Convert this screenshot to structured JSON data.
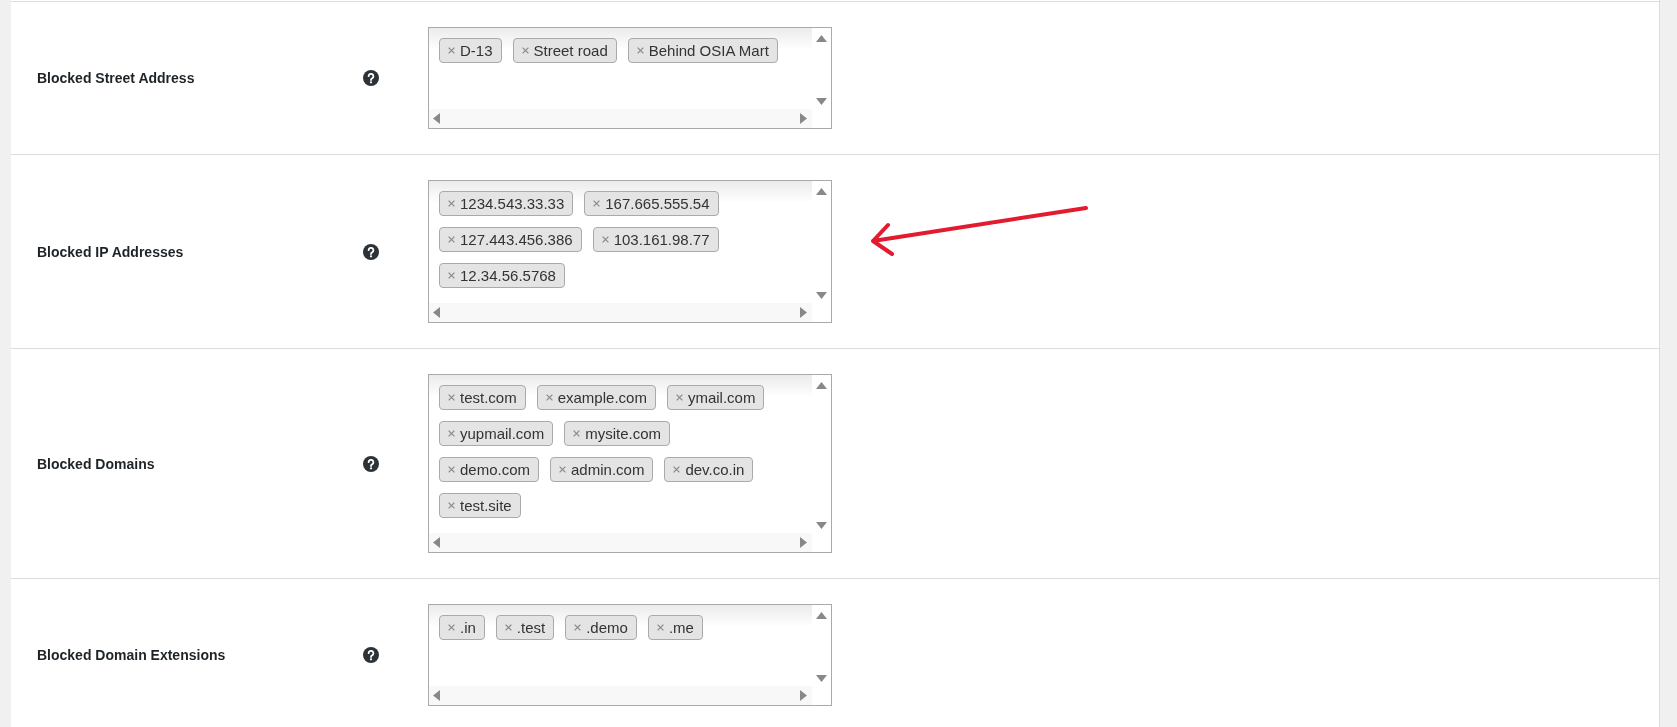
{
  "fields": [
    {
      "label": "Blocked Street Address",
      "marked": false,
      "tags": [
        "D-13",
        "Street road",
        "Behind OSIA Mart"
      ]
    },
    {
      "label": "Blocked IP Addresses",
      "marked": true,
      "tags": [
        "1234.543.33.33",
        "167.665.555.54",
        "127.443.456.386",
        "103.161.98.77",
        "12.34.56.5768"
      ]
    },
    {
      "label": "Blocked Domains",
      "marked": false,
      "tags": [
        "test.com",
        "example.com",
        "ymail.com",
        "yupmail.com",
        "mysite.com",
        "demo.com",
        "admin.com",
        "dev.co.in",
        "test.site"
      ]
    },
    {
      "label": "Blocked Domain Extensions",
      "marked": false,
      "tags": [
        ".in",
        ".test",
        ".demo",
        ".me"
      ]
    }
  ]
}
